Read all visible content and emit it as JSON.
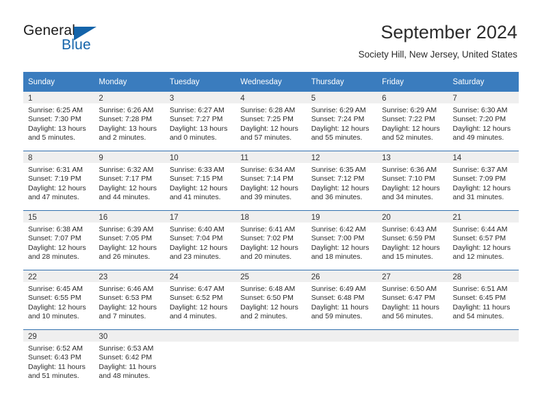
{
  "brand": {
    "word_one": "General",
    "word_two": "Blue",
    "logo_icon": "triangle-flag-icon"
  },
  "header": {
    "title": "September 2024",
    "subtitle": "Society Hill, New Jersey, United States"
  },
  "colors": {
    "header_blue": "#3a7cbe",
    "row_divider_blue": "#2f6fae",
    "daynum_band": "#efefef",
    "brand_blue": "#1464aa",
    "text": "#2a2a2a"
  },
  "weekday_headers": [
    "Sunday",
    "Monday",
    "Tuesday",
    "Wednesday",
    "Thursday",
    "Friday",
    "Saturday"
  ],
  "labels": {
    "sunrise_prefix": "Sunrise:",
    "sunset_prefix": "Sunset:",
    "daylight_prefix": "Daylight:"
  },
  "weeks": [
    [
      {
        "day": "1",
        "sunrise": "Sunrise: 6:25 AM",
        "sunset": "Sunset: 7:30 PM",
        "daylight_line1": "Daylight: 13 hours",
        "daylight_line2": "and 5 minutes."
      },
      {
        "day": "2",
        "sunrise": "Sunrise: 6:26 AM",
        "sunset": "Sunset: 7:28 PM",
        "daylight_line1": "Daylight: 13 hours",
        "daylight_line2": "and 2 minutes."
      },
      {
        "day": "3",
        "sunrise": "Sunrise: 6:27 AM",
        "sunset": "Sunset: 7:27 PM",
        "daylight_line1": "Daylight: 13 hours",
        "daylight_line2": "and 0 minutes."
      },
      {
        "day": "4",
        "sunrise": "Sunrise: 6:28 AM",
        "sunset": "Sunset: 7:25 PM",
        "daylight_line1": "Daylight: 12 hours",
        "daylight_line2": "and 57 minutes."
      },
      {
        "day": "5",
        "sunrise": "Sunrise: 6:29 AM",
        "sunset": "Sunset: 7:24 PM",
        "daylight_line1": "Daylight: 12 hours",
        "daylight_line2": "and 55 minutes."
      },
      {
        "day": "6",
        "sunrise": "Sunrise: 6:29 AM",
        "sunset": "Sunset: 7:22 PM",
        "daylight_line1": "Daylight: 12 hours",
        "daylight_line2": "and 52 minutes."
      },
      {
        "day": "7",
        "sunrise": "Sunrise: 6:30 AM",
        "sunset": "Sunset: 7:20 PM",
        "daylight_line1": "Daylight: 12 hours",
        "daylight_line2": "and 49 minutes."
      }
    ],
    [
      {
        "day": "8",
        "sunrise": "Sunrise: 6:31 AM",
        "sunset": "Sunset: 7:19 PM",
        "daylight_line1": "Daylight: 12 hours",
        "daylight_line2": "and 47 minutes."
      },
      {
        "day": "9",
        "sunrise": "Sunrise: 6:32 AM",
        "sunset": "Sunset: 7:17 PM",
        "daylight_line1": "Daylight: 12 hours",
        "daylight_line2": "and 44 minutes."
      },
      {
        "day": "10",
        "sunrise": "Sunrise: 6:33 AM",
        "sunset": "Sunset: 7:15 PM",
        "daylight_line1": "Daylight: 12 hours",
        "daylight_line2": "and 41 minutes."
      },
      {
        "day": "11",
        "sunrise": "Sunrise: 6:34 AM",
        "sunset": "Sunset: 7:14 PM",
        "daylight_line1": "Daylight: 12 hours",
        "daylight_line2": "and 39 minutes."
      },
      {
        "day": "12",
        "sunrise": "Sunrise: 6:35 AM",
        "sunset": "Sunset: 7:12 PM",
        "daylight_line1": "Daylight: 12 hours",
        "daylight_line2": "and 36 minutes."
      },
      {
        "day": "13",
        "sunrise": "Sunrise: 6:36 AM",
        "sunset": "Sunset: 7:10 PM",
        "daylight_line1": "Daylight: 12 hours",
        "daylight_line2": "and 34 minutes."
      },
      {
        "day": "14",
        "sunrise": "Sunrise: 6:37 AM",
        "sunset": "Sunset: 7:09 PM",
        "daylight_line1": "Daylight: 12 hours",
        "daylight_line2": "and 31 minutes."
      }
    ],
    [
      {
        "day": "15",
        "sunrise": "Sunrise: 6:38 AM",
        "sunset": "Sunset: 7:07 PM",
        "daylight_line1": "Daylight: 12 hours",
        "daylight_line2": "and 28 minutes."
      },
      {
        "day": "16",
        "sunrise": "Sunrise: 6:39 AM",
        "sunset": "Sunset: 7:05 PM",
        "daylight_line1": "Daylight: 12 hours",
        "daylight_line2": "and 26 minutes."
      },
      {
        "day": "17",
        "sunrise": "Sunrise: 6:40 AM",
        "sunset": "Sunset: 7:04 PM",
        "daylight_line1": "Daylight: 12 hours",
        "daylight_line2": "and 23 minutes."
      },
      {
        "day": "18",
        "sunrise": "Sunrise: 6:41 AM",
        "sunset": "Sunset: 7:02 PM",
        "daylight_line1": "Daylight: 12 hours",
        "daylight_line2": "and 20 minutes."
      },
      {
        "day": "19",
        "sunrise": "Sunrise: 6:42 AM",
        "sunset": "Sunset: 7:00 PM",
        "daylight_line1": "Daylight: 12 hours",
        "daylight_line2": "and 18 minutes."
      },
      {
        "day": "20",
        "sunrise": "Sunrise: 6:43 AM",
        "sunset": "Sunset: 6:59 PM",
        "daylight_line1": "Daylight: 12 hours",
        "daylight_line2": "and 15 minutes."
      },
      {
        "day": "21",
        "sunrise": "Sunrise: 6:44 AM",
        "sunset": "Sunset: 6:57 PM",
        "daylight_line1": "Daylight: 12 hours",
        "daylight_line2": "and 12 minutes."
      }
    ],
    [
      {
        "day": "22",
        "sunrise": "Sunrise: 6:45 AM",
        "sunset": "Sunset: 6:55 PM",
        "daylight_line1": "Daylight: 12 hours",
        "daylight_line2": "and 10 minutes."
      },
      {
        "day": "23",
        "sunrise": "Sunrise: 6:46 AM",
        "sunset": "Sunset: 6:53 PM",
        "daylight_line1": "Daylight: 12 hours",
        "daylight_line2": "and 7 minutes."
      },
      {
        "day": "24",
        "sunrise": "Sunrise: 6:47 AM",
        "sunset": "Sunset: 6:52 PM",
        "daylight_line1": "Daylight: 12 hours",
        "daylight_line2": "and 4 minutes."
      },
      {
        "day": "25",
        "sunrise": "Sunrise: 6:48 AM",
        "sunset": "Sunset: 6:50 PM",
        "daylight_line1": "Daylight: 12 hours",
        "daylight_line2": "and 2 minutes."
      },
      {
        "day": "26",
        "sunrise": "Sunrise: 6:49 AM",
        "sunset": "Sunset: 6:48 PM",
        "daylight_line1": "Daylight: 11 hours",
        "daylight_line2": "and 59 minutes."
      },
      {
        "day": "27",
        "sunrise": "Sunrise: 6:50 AM",
        "sunset": "Sunset: 6:47 PM",
        "daylight_line1": "Daylight: 11 hours",
        "daylight_line2": "and 56 minutes."
      },
      {
        "day": "28",
        "sunrise": "Sunrise: 6:51 AM",
        "sunset": "Sunset: 6:45 PM",
        "daylight_line1": "Daylight: 11 hours",
        "daylight_line2": "and 54 minutes."
      }
    ],
    [
      {
        "day": "29",
        "sunrise": "Sunrise: 6:52 AM",
        "sunset": "Sunset: 6:43 PM",
        "daylight_line1": "Daylight: 11 hours",
        "daylight_line2": "and 51 minutes."
      },
      {
        "day": "30",
        "sunrise": "Sunrise: 6:53 AM",
        "sunset": "Sunset: 6:42 PM",
        "daylight_line1": "Daylight: 11 hours",
        "daylight_line2": "and 48 minutes."
      },
      {
        "day": "",
        "sunrise": "",
        "sunset": "",
        "daylight_line1": "",
        "daylight_line2": ""
      },
      {
        "day": "",
        "sunrise": "",
        "sunset": "",
        "daylight_line1": "",
        "daylight_line2": ""
      },
      {
        "day": "",
        "sunrise": "",
        "sunset": "",
        "daylight_line1": "",
        "daylight_line2": ""
      },
      {
        "day": "",
        "sunrise": "",
        "sunset": "",
        "daylight_line1": "",
        "daylight_line2": ""
      },
      {
        "day": "",
        "sunrise": "",
        "sunset": "",
        "daylight_line1": "",
        "daylight_line2": ""
      }
    ]
  ]
}
